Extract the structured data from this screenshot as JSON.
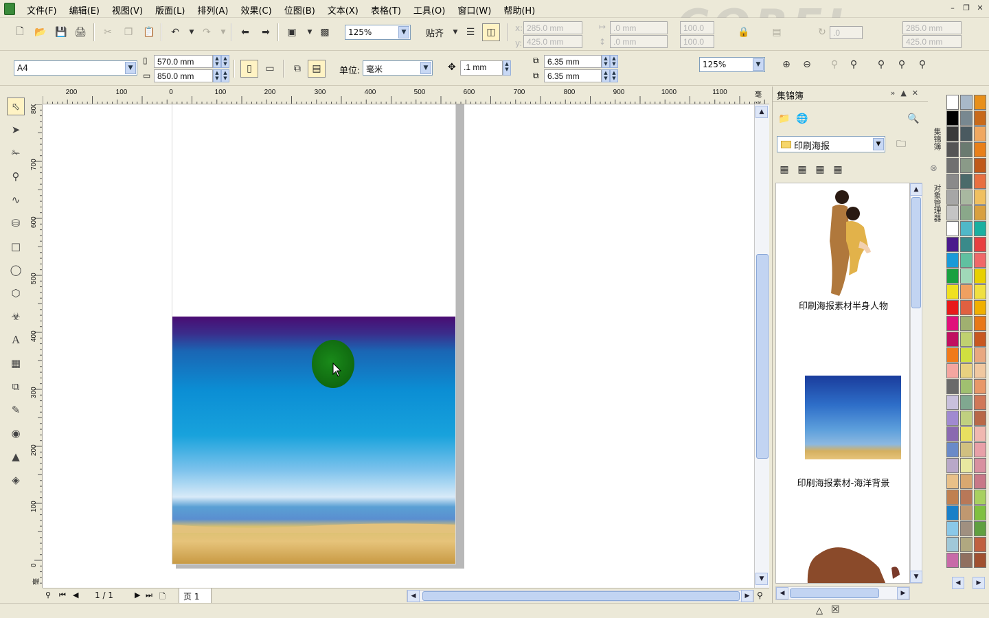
{
  "menu": [
    "文件(F)",
    "编辑(E)",
    "视图(V)",
    "版面(L)",
    "排列(A)",
    "效果(C)",
    "位图(B)",
    "文本(X)",
    "表格(T)",
    "工具(O)",
    "窗口(W)",
    "帮助(H)"
  ],
  "logo": "COREL",
  "toolbar1": {
    "zoom": "125%",
    "snap_label": "贴齐",
    "pos_x_label": "x:",
    "pos_x": "285.0 mm",
    "pos_y_label": "y:",
    "pos_y": "425.0 mm",
    "size_w": ".0 mm",
    "size_h": ".0 mm",
    "scale_x": "100.0",
    "scale_y": "100.0",
    "angle": ".0",
    "pos2_x": "285.0 mm",
    "pos2_y": "425.0 mm"
  },
  "toolbar2": {
    "paper": "A4",
    "width": "570.0 mm",
    "height": "850.0 mm",
    "unit_label": "单位:",
    "unit": "毫米",
    "nudge": ".1 mm",
    "dup_x": "6.35 mm",
    "dup_y": "6.35 mm",
    "zoom": "125%"
  },
  "ruler": {
    "h_labels": [
      "200",
      "100",
      "0",
      "100",
      "200",
      "300",
      "400",
      "500",
      "600",
      "700",
      "800",
      "900",
      "1000",
      "1100",
      "毫米"
    ],
    "v_labels": [
      "800",
      "700",
      "600",
      "500",
      "400",
      "300",
      "200",
      "100",
      "0",
      "毫米"
    ]
  },
  "pager": {
    "count": "1 / 1",
    "tab": "页 1"
  },
  "docker": {
    "title": "集锦簿",
    "folder": "印刷海报",
    "items": [
      {
        "label": "印刷海报素材半身人物"
      },
      {
        "label": "印刷海报素材-海洋背景"
      }
    ],
    "side_tabs": [
      "集锦簿",
      "对象管理器"
    ]
  },
  "colors": {
    "accent": "#fff3c4",
    "green_ball": "#0b5a0b"
  }
}
